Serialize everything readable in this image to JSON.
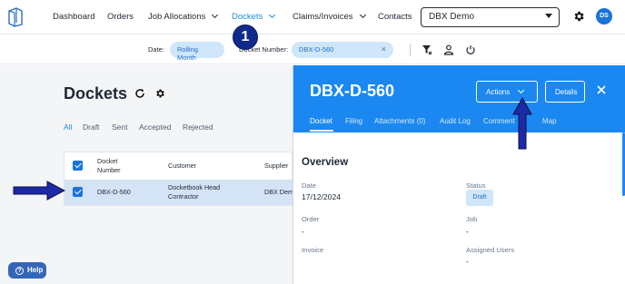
{
  "nav": {
    "items": [
      {
        "label": "Dashboard",
        "dropdown": false
      },
      {
        "label": "Orders",
        "dropdown": false
      },
      {
        "label": "Job Allocations",
        "dropdown": true
      },
      {
        "label": "Dockets",
        "dropdown": true,
        "active": true
      },
      {
        "label": "Claims/Invoices",
        "dropdown": true
      },
      {
        "label": "Contacts",
        "dropdown": false
      }
    ],
    "company_select": "DBX Demo",
    "avatar_initials": "DS",
    "icons": {
      "logo": "app-logo-icon",
      "settings": "gear-icon"
    }
  },
  "filters": {
    "date_label": "Date:",
    "date_value": "Rolling Month",
    "docket_label": "Docket Number:",
    "docket_value": "DBX-D-560",
    "clear_glyph": "×",
    "icons": [
      "filter-clear-icon",
      "person-icon",
      "power-icon"
    ]
  },
  "main": {
    "title": "Dockets",
    "tabs": [
      "All",
      "Draft",
      "Sent",
      "Accepted",
      "Rejected"
    ],
    "active_tab": "All",
    "table": {
      "headers": [
        "Docket Number",
        "Customer",
        "Supplier"
      ],
      "rows": [
        {
          "docket": "DBX-D-560",
          "customer": "Docketbook Head Contractor",
          "supplier": "DBX Demo",
          "selected": true
        }
      ]
    }
  },
  "help_button": "Help",
  "panel": {
    "title": "DBX-D-560",
    "actions_label": "Actions",
    "details_label": "Details",
    "tabs": [
      "Docket",
      "Filing",
      "Attachments (0)",
      "Audit Log",
      "Comment",
      "Map"
    ],
    "active_tab": "Docket",
    "section_title": "Overview",
    "fields": {
      "date_label": "Date",
      "date_value": "17/12/2024",
      "status_label": "Status",
      "status_value": "Draft",
      "order_label": "Order",
      "order_value": "-",
      "job_label": "Job",
      "job_value": "-",
      "invoice_label": "Invoice",
      "assigned_label": "Assigned Users",
      "assigned_value": "-"
    }
  },
  "annotation": {
    "step_number": "1",
    "arrow_color": "#1d2aa6"
  },
  "colors": {
    "accent": "#1a88f0",
    "active_nav": "#1a8fe3",
    "chip_bg": "#cfe6fb",
    "row_selected": "#d4e3f5",
    "help_bg": "#3466b8"
  }
}
